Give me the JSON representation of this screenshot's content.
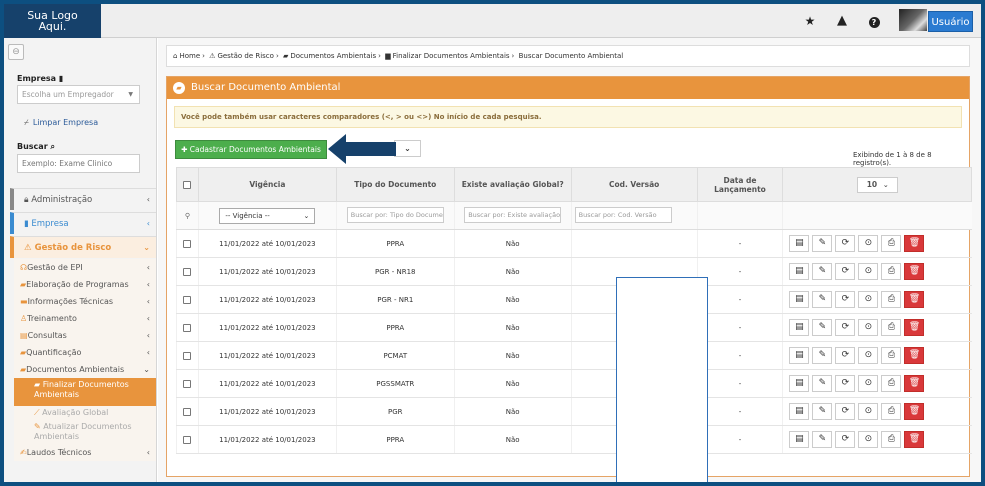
{
  "topbar": {
    "logo": "Sua Logo\nAqui.",
    "logo_line1": "Sua Logo",
    "logo_line2": "Aqui.",
    "user_label": "Usuário",
    "icons": [
      "star-icon",
      "warning-icon",
      "help-icon"
    ]
  },
  "sidebar": {
    "empresa_label": "Empresa",
    "empresa_placeholder": "Escolha um Empregador",
    "limpar_label": "Limpar Empresa",
    "buscar_label": "Buscar",
    "buscar_value": "Exemplo: Exame Clinico",
    "menu": [
      {
        "label": "Administração",
        "color": "#888888"
      },
      {
        "label": "Empresa",
        "color": "#3a8bd0"
      },
      {
        "label": "Gestão de Risco",
        "color": "#e8943d"
      }
    ],
    "risk_submenu": [
      "Gestão de EPI",
      "Elaboração de Programas",
      "Informações Técnicas",
      "Treinamento",
      "Consultas",
      "Quantificação",
      "Documentos Ambientais"
    ],
    "doc_submenu": [
      "Finalizar Documentos Ambientais",
      "Avaliação Global",
      "Atualizar Documentos Ambientais"
    ],
    "last_item": "Laudos Técnicos"
  },
  "breadcrumb": [
    "Home",
    "Gestão de Risco",
    "Documentos Ambientais",
    "Finalizar Documentos Ambientais",
    "Buscar Documento Ambiental"
  ],
  "panel": {
    "title": "Buscar Documento Ambiental",
    "alert": "Você pode também usar caracteres comparadores (<, > ou <>) No início de cada pesquisa.",
    "add_button": "Cadastrar Documentos Ambientais",
    "showing": "Exibindo de 1 à 8 de 8 registro(s).",
    "per_page": "10"
  },
  "table": {
    "headers": [
      "Vigência",
      "Tipo do Documento",
      "Existe avaliação Global?",
      "Cod. Versão",
      "Data de Lançamento"
    ],
    "filters": {
      "vigencia": "-- Vigência --",
      "tipo": "Buscar por: Tipo do Documento",
      "avaliacao": "Buscar por: Existe avaliação Global?",
      "versao": "Buscar por: Cod. Versão"
    },
    "rows": [
      {
        "vigencia": "11/01/2022 até 10/01/2023",
        "tipo": "PPRA",
        "avaliacao": "Não",
        "versao": "",
        "data": "-"
      },
      {
        "vigencia": "11/01/2022 até 10/01/2023",
        "tipo": "PGR - NR18",
        "avaliacao": "Não",
        "versao": "",
        "data": "-"
      },
      {
        "vigencia": "11/01/2022 até 10/01/2023",
        "tipo": "PGR - NR1",
        "avaliacao": "Não",
        "versao": "",
        "data": "-"
      },
      {
        "vigencia": "11/01/2022 até 10/01/2023",
        "tipo": "PPRA",
        "avaliacao": "Não",
        "versao": "",
        "data": "-"
      },
      {
        "vigencia": "11/01/2022 até 10/01/2023",
        "tipo": "PCMAT",
        "avaliacao": "Não",
        "versao": "",
        "data": "-"
      },
      {
        "vigencia": "11/01/2022 até 10/01/2023",
        "tipo": "PGSSMATR",
        "avaliacao": "Não",
        "versao": "",
        "data": "-"
      },
      {
        "vigencia": "11/01/2022 até 10/01/2023",
        "tipo": "PGR",
        "avaliacao": "Não",
        "versao": "",
        "data": "-"
      },
      {
        "vigencia": "11/01/2022 até 10/01/2023",
        "tipo": "PPRA",
        "avaliacao": "Não",
        "versao": "",
        "data": "-"
      }
    ],
    "row_actions": [
      "list-icon",
      "edit-icon",
      "refresh-icon",
      "check-icon",
      "print-icon",
      "trash-icon"
    ]
  },
  "colors": {
    "accent": "#e8943d",
    "add_button": "#4cae4c",
    "user_button": "#2a7bd1",
    "logo_bg": "#16416b",
    "delete": "#d9383a"
  }
}
